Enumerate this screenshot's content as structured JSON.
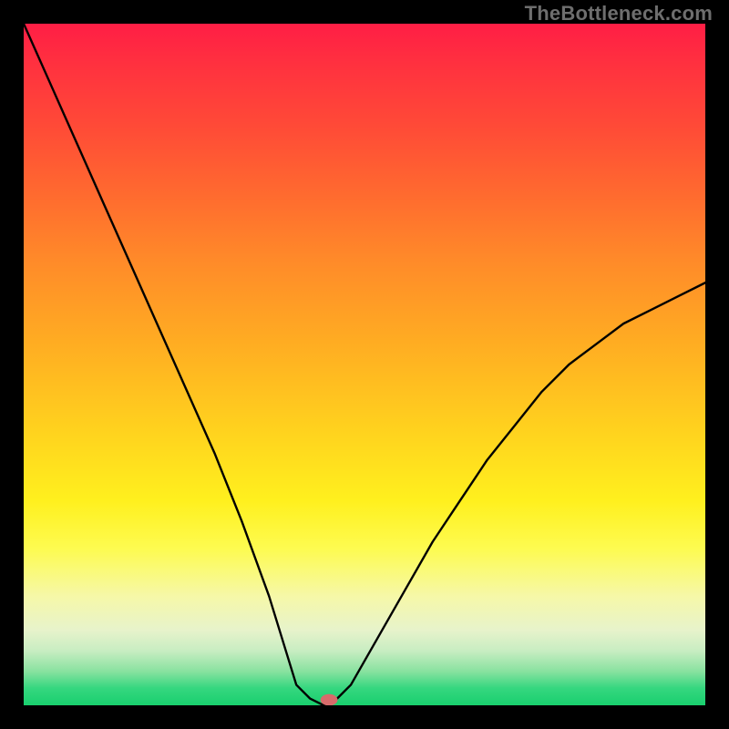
{
  "watermark": {
    "text": "TheBottleneck.com"
  },
  "chart_data": {
    "type": "line",
    "title": "",
    "xlabel": "",
    "ylabel": "",
    "xlim": [
      0,
      1000
    ],
    "ylim": [
      0,
      100
    ],
    "x_optimum": 440,
    "y_at_optimum": 0,
    "flat_bottom_range": [
      400,
      460
    ],
    "marker": {
      "x": 448,
      "y": 0.8,
      "color": "#d86b6b"
    },
    "series": [
      {
        "name": "bottleneck-curve",
        "x": [
          0,
          40,
          80,
          120,
          160,
          200,
          240,
          280,
          320,
          360,
          400,
          420,
          440,
          460,
          480,
          520,
          560,
          600,
          640,
          680,
          720,
          760,
          800,
          840,
          880,
          920,
          960,
          1000
        ],
        "values": [
          100,
          91,
          82,
          73,
          64,
          55,
          46,
          37,
          27,
          16,
          3,
          1,
          0,
          1,
          3,
          10,
          17,
          24,
          30,
          36,
          41,
          46,
          50,
          53,
          56,
          58,
          60,
          62
        ]
      }
    ],
    "gradient_stops": [
      {
        "pct": 0,
        "color": "#ff1e45"
      },
      {
        "pct": 15,
        "color": "#ff4a37"
      },
      {
        "pct": 35,
        "color": "#ff8b29"
      },
      {
        "pct": 60,
        "color": "#ffd31e"
      },
      {
        "pct": 77,
        "color": "#fdfb50"
      },
      {
        "pct": 92,
        "color": "#c8edc2"
      },
      {
        "pct": 100,
        "color": "#19cf6e"
      }
    ]
  }
}
